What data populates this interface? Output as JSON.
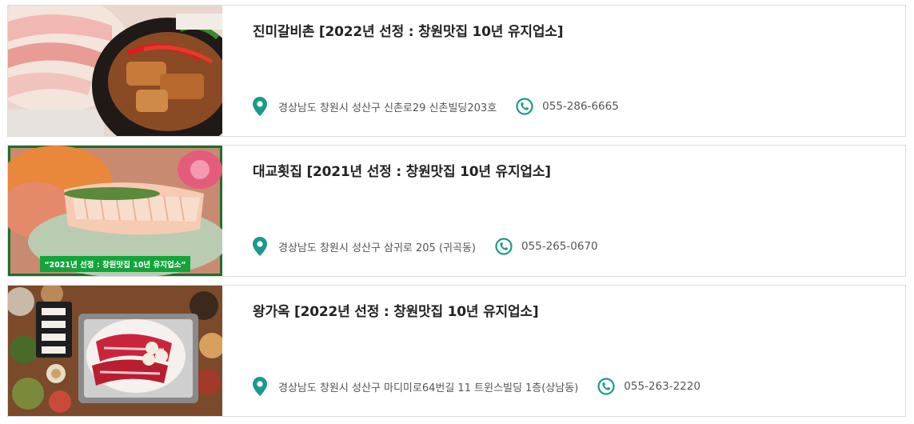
{
  "restaurants": [
    {
      "name": "진미갈비촌 [2022년 선정 : 창원맛집 10년 유지업소]",
      "address": "경상남도 창원시 성산구 신촌로29 신촌빌딩203호",
      "phone": "055-286-6665",
      "image_icon": "food-photo-grilled-pork-ribs"
    },
    {
      "name": "대교횟집 [2021년 선정 : 창원맛집 10년 유지업소]",
      "address": "경상남도 창원시 성산구 삼귀로 205 (귀곡동)",
      "phone": "055-265-0670",
      "image_icon": "food-photo-sashimi-platter",
      "image_caption": "“2021년 선정 : 창원맛집 10년 유지업소”"
    },
    {
      "name": "왕가옥 [2022년 선정 : 창원맛집 10년 유지업소]",
      "address": "경상남도 창원시 성산구 마디미로64번길 11 트윈스빌딩 1층(상남동)",
      "phone": "055-263-2220",
      "image_icon": "food-photo-beef-grill-table"
    }
  ],
  "icons": {
    "address": "map-pin-icon",
    "phone": "phone-icon"
  },
  "colors": {
    "accent": "#1a9a8a",
    "border": "#dcdcdc"
  }
}
